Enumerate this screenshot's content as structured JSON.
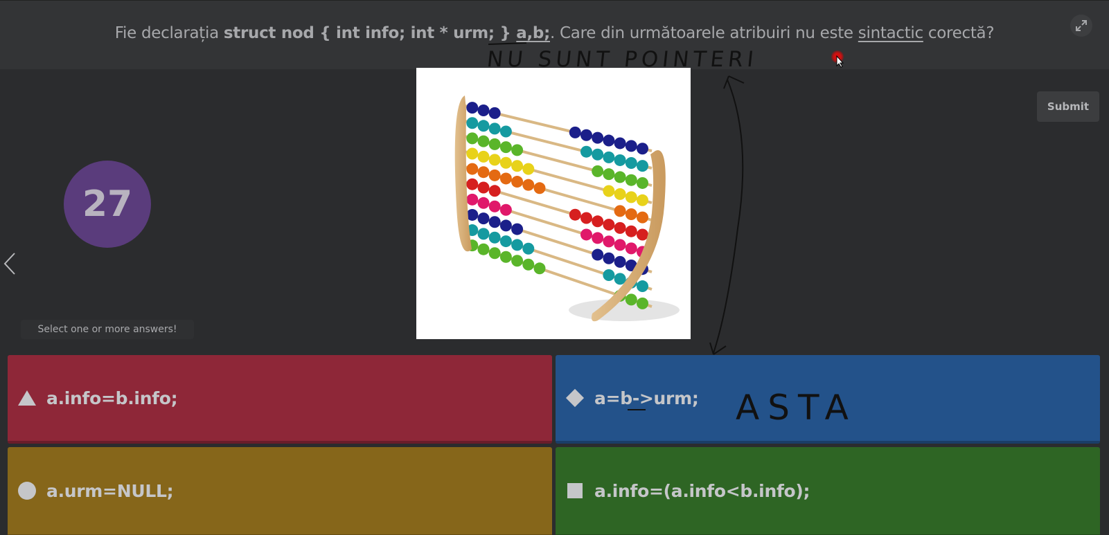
{
  "question": {
    "prefix": "Fie declarația ",
    "code": "struct nod { int info; int * urm; } ",
    "vars": "a,b;",
    "middle": ". Care din următoarele atribuiri nu este ",
    "emph": "sintactic",
    "suffix": " corectă?"
  },
  "counter": "27",
  "hint": "Select one or more answers!",
  "submit_label": "Submit",
  "answers": [
    {
      "shape": "triangle-icon",
      "text": "a.info=b.info;",
      "color": "#8e2738"
    },
    {
      "shape": "diamond-icon",
      "text": "a=b->urm;",
      "color": "#23528a"
    },
    {
      "shape": "circle-icon",
      "text": "a.urm=NULL;",
      "color": "#86661a"
    },
    {
      "shape": "square-icon",
      "text": "a.info=(a.info<b.info);",
      "color": "#2e6524"
    }
  ],
  "annotations": {
    "top_note": "NU SUNT POINTERI",
    "answer_note": "ASTA"
  },
  "colors": {
    "background": "#2b2c2e",
    "header": "#333436",
    "counter_bg": "#5a3c7c"
  }
}
